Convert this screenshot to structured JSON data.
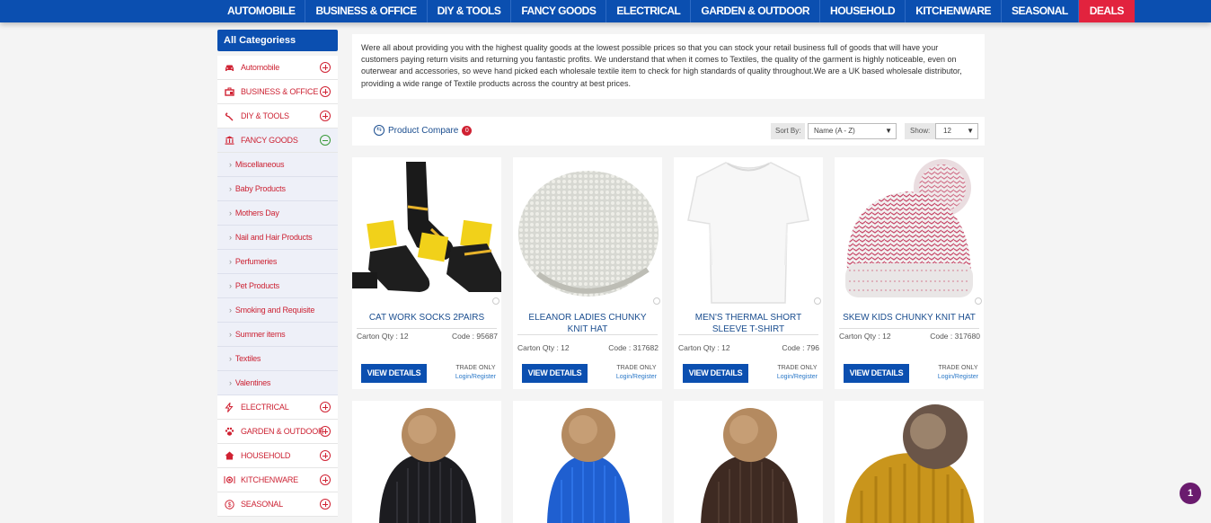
{
  "nav": {
    "items": [
      "AUTOMOBILE",
      "BUSINESS & OFFICE",
      "DIY & TOOLS",
      "FANCY GOODS",
      "ELECTRICAL",
      "GARDEN & OUTDOOR",
      "HOUSEHOLD",
      "KITCHENWARE",
      "SEASONAL",
      "DEALS"
    ]
  },
  "sidebar": {
    "title": "All Categoriess",
    "items": [
      {
        "label": "Automobile",
        "icon": "car-icon",
        "toggle": "plus"
      },
      {
        "label": "BUSINESS & OFFICE",
        "icon": "briefcase-icon",
        "toggle": "plus"
      },
      {
        "label": "DIY & TOOLS",
        "icon": "wrench-icon",
        "toggle": "plus"
      },
      {
        "label": "FANCY GOODS",
        "icon": "bank-icon",
        "toggle": "minus"
      }
    ],
    "subitems": [
      "Miscellaneous",
      "Baby Products",
      "Mothers Day",
      "Nail and Hair Products",
      "Perfumeries",
      "Pet Products",
      "Smoking and Requisite",
      "Summer items",
      "Textiles",
      "Valentines"
    ],
    "bottom_items": [
      {
        "label": "ELECTRICAL",
        "icon": "lightning-icon"
      },
      {
        "label": "GARDEN & OUTDOOR",
        "icon": "paw-icon"
      },
      {
        "label": "HOUSEHOLD",
        "icon": "house-icon"
      },
      {
        "label": "KITCHENWARE",
        "icon": "dish-icon"
      },
      {
        "label": "SEASONAL",
        "icon": "dollar-icon"
      }
    ]
  },
  "description": "Were all about providing you with the highest quality goods at the lowest possible prices so that you can stock your retail business full of goods that will have your customers paying return visits and returning you fantastic profits. We understand that when it comes to Textiles, the quality of the garment is highly noticeable, even on outerwear and accessories, so weve hand picked each wholesale textile item to check for high standards of quality throughout.We are a UK based wholesale distributor, providing a wide range of Textile products across the country at best prices.",
  "toolbar": {
    "compare_label": "Product Compare",
    "compare_count": "0",
    "sort_label": "Sort By:",
    "sort_value": "Name (A - Z)",
    "show_label": "Show:",
    "show_value": "12"
  },
  "products": [
    {
      "name": "CAT WORK SOCKS 2PAIRS",
      "qty": "Carton Qty : 12",
      "code": "Code : 95687",
      "button": "VIEW DETAILS",
      "trade": "TRADE ONLY",
      "login": "Login/Register"
    },
    {
      "name": "ELEANOR LADIES CHUNKY KNIT HAT",
      "qty": "Carton Qty : 12",
      "code": "Code : 317682",
      "button": "VIEW DETAILS",
      "trade": "TRADE ONLY",
      "login": "Login/Register"
    },
    {
      "name": "MEN'S THERMAL SHORT SLEEVE T-SHIRT",
      "qty": "Carton Qty : 12",
      "code": "Code : 796",
      "button": "VIEW DETAILS",
      "trade": "TRADE ONLY",
      "login": "Login/Register"
    },
    {
      "name": "SKEW KIDS CHUNKY KNIT HAT",
      "qty": "Carton Qty : 12",
      "code": "Code : 317680",
      "button": "VIEW DETAILS",
      "trade": "TRADE ONLY",
      "login": "Login/Register"
    }
  ],
  "help_badge": "1",
  "colors": {
    "nav": "#0b4fb0",
    "deals": "#e2233e",
    "category_text": "#cc2233",
    "link": "#1a4d8f"
  }
}
